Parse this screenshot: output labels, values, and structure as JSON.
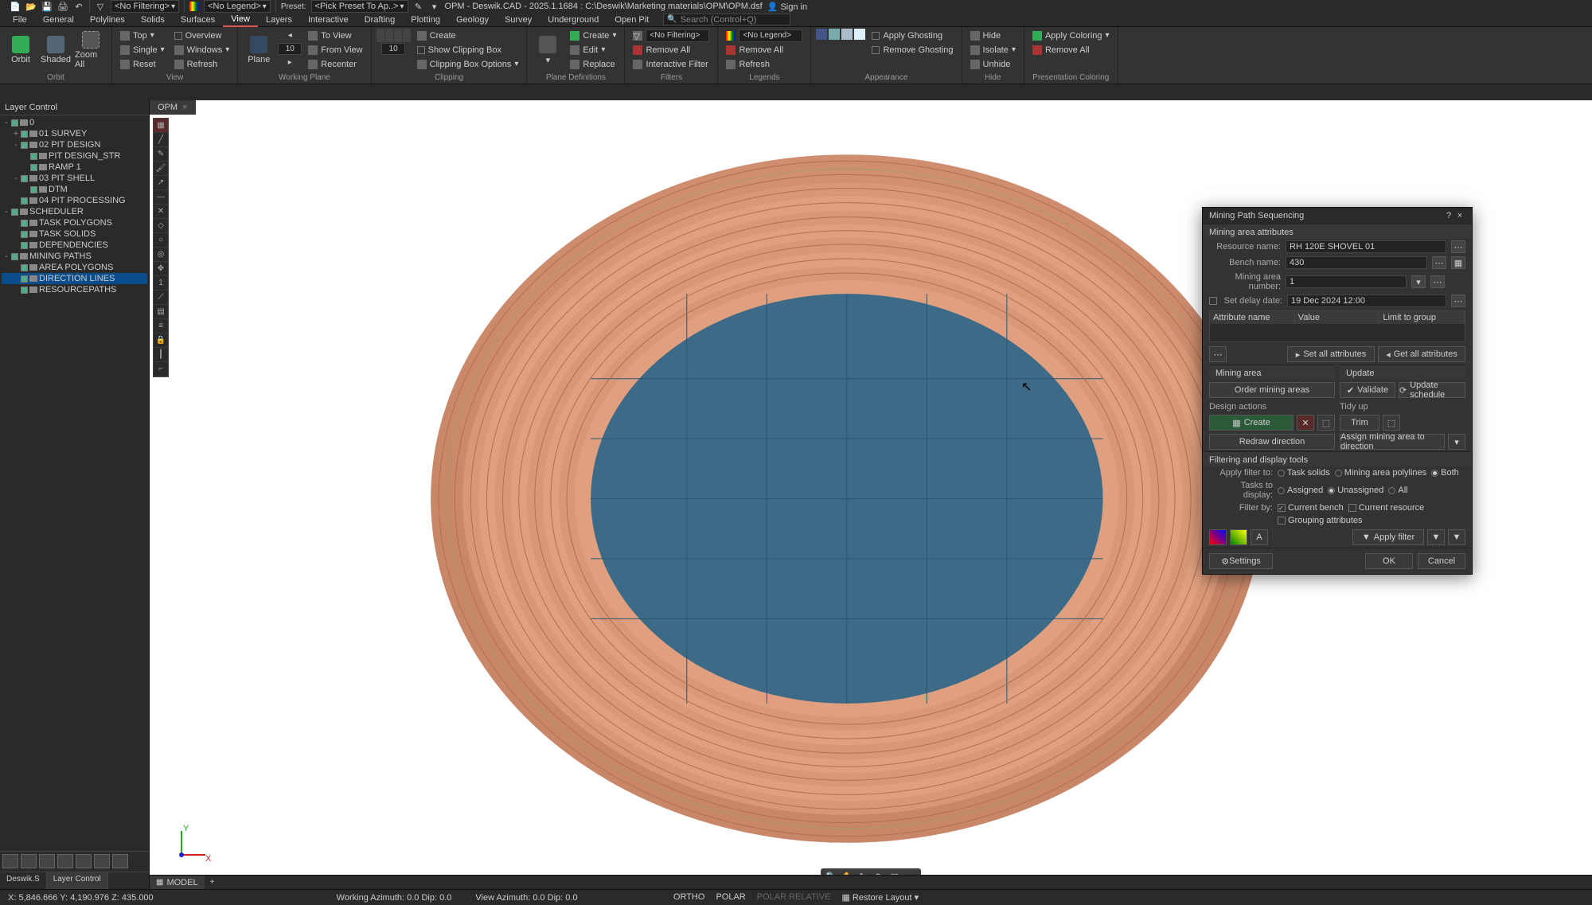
{
  "app": {
    "title": "OPM - Deswik.CAD - 2025.1.1684 : C:\\Deswik\\Marketing materials\\OPM\\OPM.dsf",
    "signin": "Sign in"
  },
  "qat": {
    "filter": "<No Filtering>",
    "legend": "<No Legend>",
    "preset_lbl": "Preset:",
    "preset": "<Pick Preset To Ap..>"
  },
  "menus": [
    "File",
    "General",
    "Polylines",
    "Solids",
    "Surfaces",
    "View",
    "Layers",
    "Interactive",
    "Drafting",
    "Plotting",
    "Geology",
    "Survey",
    "Underground",
    "Open Pit"
  ],
  "active_menu": "View",
  "search_ph": "Search (Control+Q)",
  "ribbon": {
    "orbit": {
      "lbl": "Orbit",
      "b1": "Orbit",
      "b2": "Shaded",
      "b3": "Zoom All"
    },
    "view": {
      "lbl": "View",
      "top": "Top",
      "single": "Single",
      "reset": "Reset",
      "overview": "Overview",
      "windows": "Windows",
      "refresh": "Refresh"
    },
    "wplane": {
      "lbl": "Working Plane",
      "spin": "10",
      "toview": "To View",
      "fromview": "From View",
      "recenter": "Recenter"
    },
    "clipping": {
      "lbl": "Clipping",
      "spin": "10",
      "create": "Create",
      "show": "Show Clipping Box",
      "opts": "Clipping Box Options"
    },
    "pdef": {
      "lbl": "Plane Definitions",
      "create": "Create",
      "edit": "Edit",
      "replace": "Replace"
    },
    "filters": {
      "lbl": "Filters",
      "dd": "<No Filtering>",
      "remove": "Remove All",
      "inter": "Interactive Filter"
    },
    "legends": {
      "lbl": "Legends",
      "dd": "<No Legend>",
      "remove": "Remove All",
      "refresh": "Refresh"
    },
    "appear": {
      "lbl": "Appearance",
      "ghost": "Apply Ghosting",
      "rghost": "Remove Ghosting"
    },
    "hide": {
      "lbl": "Hide",
      "hide": "Hide",
      "isolate": "Isolate",
      "unhide": "Unhide"
    },
    "pres": {
      "lbl": "Presentation Coloring",
      "apply": "Apply Coloring",
      "remove": "Remove All"
    }
  },
  "layer_panel": {
    "title": "Layer Control"
  },
  "tree": [
    {
      "ind": 0,
      "exp": "-",
      "name": "0"
    },
    {
      "ind": 1,
      "exp": "+",
      "name": "01 SURVEY"
    },
    {
      "ind": 1,
      "exp": "-",
      "name": "02 PIT DESIGN"
    },
    {
      "ind": 2,
      "exp": "",
      "name": "PIT DESIGN_STR"
    },
    {
      "ind": 2,
      "exp": "",
      "name": "RAMP 1"
    },
    {
      "ind": 1,
      "exp": "-",
      "name": "03 PIT SHELL"
    },
    {
      "ind": 2,
      "exp": "",
      "name": "DTM"
    },
    {
      "ind": 1,
      "exp": "",
      "name": "04 PIT PROCESSING"
    },
    {
      "ind": 0,
      "exp": "-",
      "name": "SCHEDULER"
    },
    {
      "ind": 1,
      "exp": "",
      "name": "TASK POLYGONS"
    },
    {
      "ind": 1,
      "exp": "",
      "name": "TASK SOLIDS"
    },
    {
      "ind": 1,
      "exp": "",
      "name": "DEPENDENCIES"
    },
    {
      "ind": 0,
      "exp": "-",
      "name": "MINING PATHS"
    },
    {
      "ind": 1,
      "exp": "",
      "name": "AREA POLYGONS"
    },
    {
      "ind": 1,
      "exp": "",
      "name": "DIRECTION LINES",
      "sel": true
    },
    {
      "ind": 1,
      "exp": "",
      "name": "RESOURCEPATHS"
    }
  ],
  "side_tabs": {
    "t1": "Deswik.S",
    "t2": "Layer Control"
  },
  "doc_tab": "OPM",
  "model_tab": "MODEL",
  "dlg": {
    "title": "Mining Path Sequencing",
    "sec_attr": "Mining area attributes",
    "resource_lbl": "Resource name:",
    "resource": "RH 120E SHOVEL 01",
    "bench_lbl": "Bench name:",
    "bench": "430",
    "areanum_lbl": "Mining area number:",
    "areanum": "1",
    "delay_lbl": "Set delay date:",
    "delay": "19 Dec 2024 12:00",
    "th1": "Attribute name",
    "th2": "Value",
    "th3": "Limit to group",
    "setall": "Set all attributes",
    "getall": "Get all attributes",
    "sec_area": "Mining area",
    "sec_update": "Update",
    "order": "Order mining areas",
    "validate": "Validate",
    "upsched": "Update schedule",
    "design_lbl": "Design actions",
    "tidy_lbl": "Tidy up",
    "create": "Create",
    "trim": "Trim",
    "redraw": "Redraw direction",
    "assign": "Assign mining area to direction",
    "sec_filter": "Filtering and display tools",
    "applyto_lbl": "Apply filter to:",
    "r_task": "Task solids",
    "r_poly": "Mining area polylines",
    "r_both": "Both",
    "tasks_lbl": "Tasks to display:",
    "r_assigned": "Assigned",
    "r_unassigned": "Unassigned",
    "r_all": "All",
    "filterby_lbl": "Filter by:",
    "c_bench": "Current bench",
    "c_res": "Current resource",
    "c_group": "Grouping attributes",
    "applyf": "Apply filter",
    "settings": "Settings",
    "ok": "OK",
    "cancel": "Cancel"
  },
  "status": {
    "coords": "X: 5,846.666    Y: 4,190.976    Z: 435.000",
    "wazim": "Working Azimuth: 0.0 Dip: 0.0",
    "vazim": "View Azimuth: 0.0 Dip: 0.0",
    "ortho": "ORTHO",
    "polar": "POLAR",
    "prel": "POLAR RELATIVE",
    "restore": "Restore Layout"
  }
}
